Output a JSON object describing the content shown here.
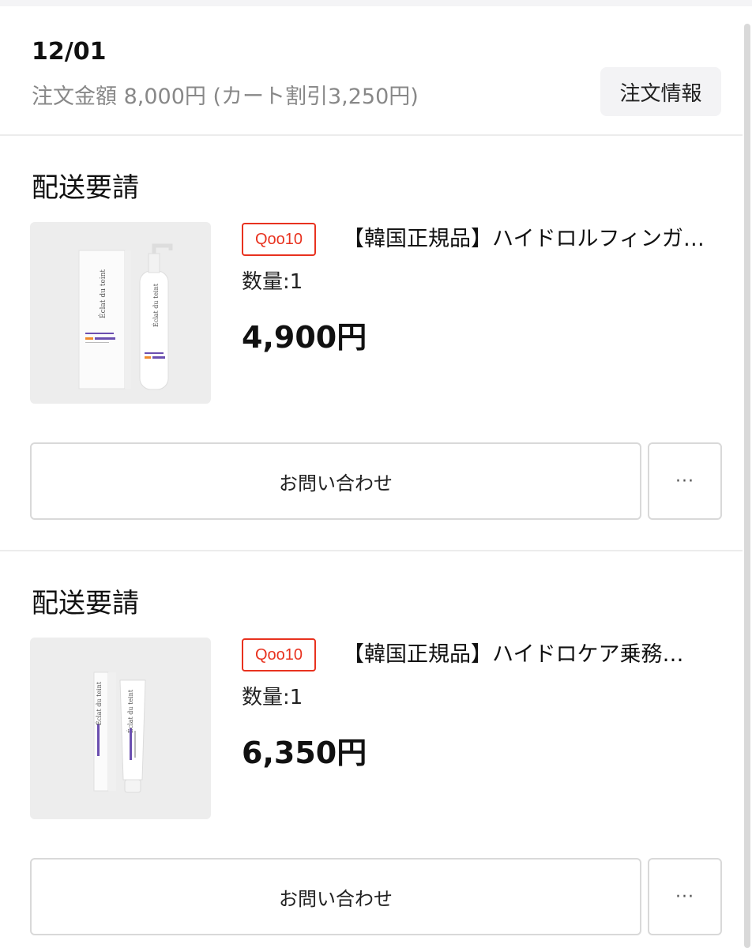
{
  "order": {
    "date": "12/01",
    "amount_text": "注文金額 8,000円 (カート割引3,250円)",
    "info_button_label": "注文情報"
  },
  "items": [
    {
      "status": "配送要請",
      "shop_badge": "Qoo10",
      "product_name": "【韓国正規品】ハイドロルフィンガ…",
      "quantity": "数量:1",
      "price": "4,900円",
      "inquiry_label": "お問い合わせ",
      "more_label": "···",
      "thumbnail_brand": "Éclat du teint",
      "thumbnail_type": "bottle-pump"
    },
    {
      "status": "配送要請",
      "shop_badge": "Qoo10",
      "product_name": "【韓国正規品】ハイドロケア乗務…",
      "quantity": "数量:1",
      "price": "6,350円",
      "inquiry_label": "お問い合わせ",
      "more_label": "···",
      "thumbnail_brand": "Éclat du teint",
      "thumbnail_type": "tube"
    }
  ],
  "colors": {
    "badge": "#e8321f",
    "divider": "#ececec",
    "thumb_bg": "#ededed",
    "accent_purple": "#6b4fb0",
    "accent_orange": "#f08a2c"
  }
}
